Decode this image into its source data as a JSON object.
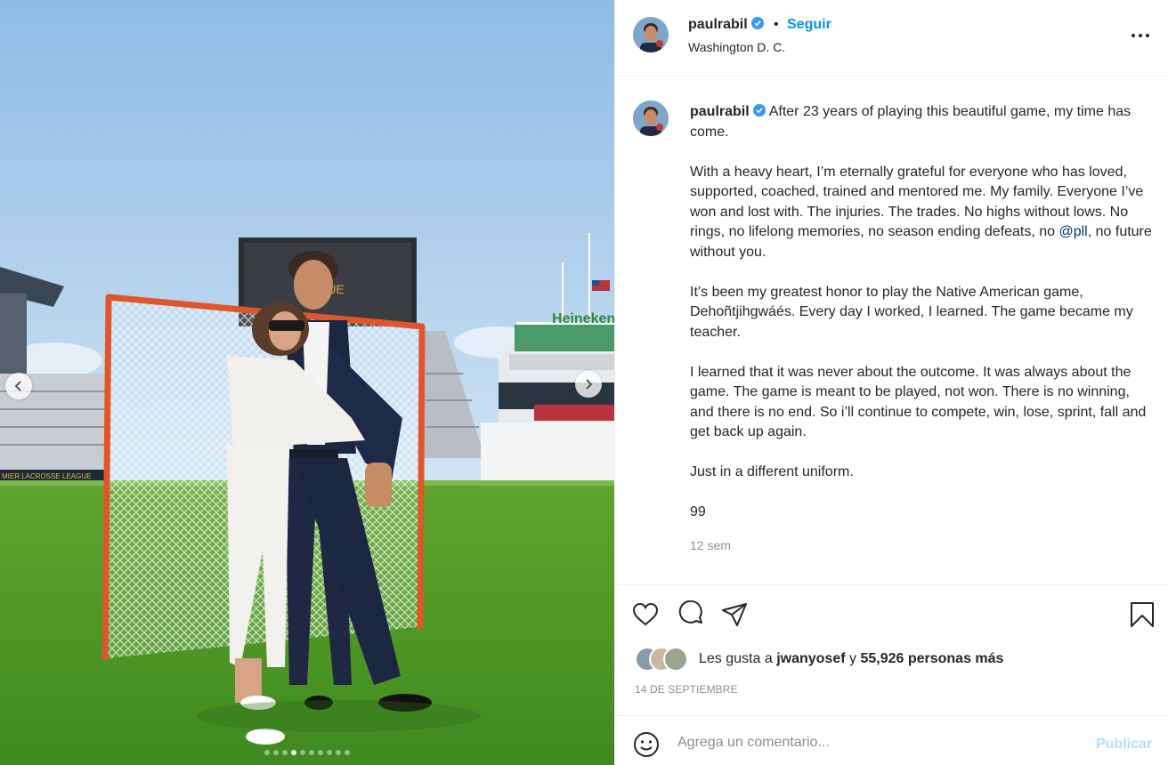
{
  "colors": {
    "accent": "#0095f6",
    "text": "#262626",
    "muted": "#8e8e8e",
    "link": "#00376b",
    "publish_disabled": "#b2dffc",
    "divider": "#efefef"
  },
  "media": {
    "signage": {
      "sponsor": "Heineken",
      "league_strip": "MIER LACROSSE LEAGUE",
      "scoreboard": "LEAGUE"
    },
    "carousel": {
      "total": 10,
      "active_index": 3
    }
  },
  "header": {
    "username": "paulrabil",
    "separator": "•",
    "follow_label": "Seguir",
    "location": "Washington D. C."
  },
  "caption": {
    "username": "paulrabil",
    "first_line": "After 23 years of playing this beautiful game, my time has come.",
    "p2_before": "With a heavy heart, I’m eternally grateful for everyone who has loved, supported, coached, trained and mentored me. My family. Everyone I’ve won and lost with. The injuries. The trades. No highs without lows. No rings, no lifelong memories, no season ending defeats, no ",
    "p2_mention": "@pll",
    "p2_after": ", no future without you.",
    "p3": "It’s been my greatest honor to play the Native American game, Dehoñtjihgwáés. Every day I worked, I learned. The game became my teacher.",
    "p4": "I learned that it was never about the outcome. It was always about the game. The game is meant to be played, not won. There is no winning, and there is no end. So i’ll continue to compete, win, lose, sprint, fall and get back up again.",
    "p5": "Just in a different uniform.",
    "p6": "99",
    "age": "12 sem"
  },
  "likes": {
    "prefix": "Les gusta a",
    "user": "jwanyosef",
    "conjunction": "y",
    "count_text": "55,926 personas más"
  },
  "date": "14 DE SEPTIEMBRE",
  "comment": {
    "placeholder": "Agrega un comentario...",
    "publish_label": "Publicar"
  },
  "icons": {
    "like": "heart-icon",
    "comment": "speech-bubble-icon",
    "share": "paper-plane-icon",
    "save": "bookmark-icon",
    "emoji": "smiley-icon",
    "more": "ellipsis-icon",
    "verified": "verified-badge-icon"
  }
}
